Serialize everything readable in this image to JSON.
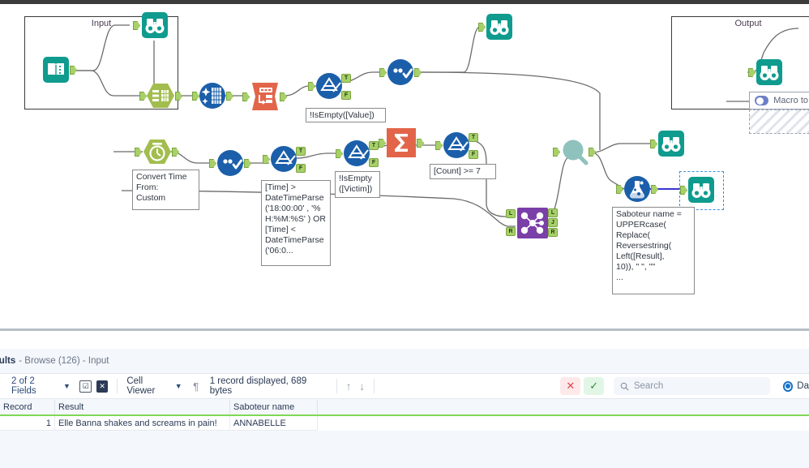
{
  "canvas": {
    "containers": [
      {
        "id": "input",
        "title": "Input"
      },
      {
        "id": "output",
        "title": "Output"
      }
    ],
    "macro_toggle": {
      "label": "Macro to",
      "state": "off"
    },
    "annotations": [
      {
        "id": "filter-value",
        "text": "!IsEmpty([Value])"
      },
      {
        "id": "convert-time",
        "text": "Convert Time\nFrom:\nCustom"
      },
      {
        "id": "time-filter",
        "text": "[Time]  >\nDateTimeParse\n('18:00:00' , '%\nH:%M:%S' ) OR\n[Time]  <\nDateTimeParse\n('06:0..."
      },
      {
        "id": "filter-victim",
        "text": "!IsEmpty\n([Victim])"
      },
      {
        "id": "count-filter",
        "text": "[Count] >= 7"
      },
      {
        "id": "formula-sab",
        "text": "Saboteur name =\nUPPERcase(\nReplace(\nReversestring(\nLeft([Result],\n10)), \" \", \"\"\n..."
      }
    ],
    "tools": [
      {
        "id": "input-data",
        "name": "input-data-tool",
        "icon": "book-icon",
        "color": "#0f9b8e"
      },
      {
        "id": "browse-top-1",
        "name": "browse-tool",
        "icon": "binoculars-icon",
        "color": "#0f9b8e"
      },
      {
        "id": "text-to-columns",
        "name": "text-to-columns-tool",
        "icon": "table-hex-icon",
        "color": "#a2bd4e"
      },
      {
        "id": "data-cleansing",
        "name": "data-cleansing-tool",
        "icon": "cleanse-icon",
        "color": "#1b5faa"
      },
      {
        "id": "transpose",
        "name": "transpose-tool",
        "icon": "transpose-icon",
        "color": "#e2654a"
      },
      {
        "id": "filter-1",
        "name": "filter-tool",
        "icon": "filter-icon",
        "color": "#1b5faa"
      },
      {
        "id": "select-1",
        "name": "select-tool",
        "icon": "select-icon",
        "color": "#1b5faa"
      },
      {
        "id": "browse-top-2",
        "name": "browse-tool",
        "icon": "binoculars-icon",
        "color": "#0f9b8e"
      },
      {
        "id": "browse-output",
        "name": "browse-tool",
        "icon": "binoculars-icon",
        "color": "#0f9b8e"
      },
      {
        "id": "datetime",
        "name": "datetime-tool",
        "icon": "clock-hex-icon",
        "color": "#a2bd4e"
      },
      {
        "id": "select-2",
        "name": "select-tool",
        "icon": "select-icon",
        "color": "#1b5faa"
      },
      {
        "id": "filter-2",
        "name": "filter-tool",
        "icon": "filter-icon",
        "color": "#1b5faa"
      },
      {
        "id": "filter-3",
        "name": "filter-tool",
        "icon": "filter-icon",
        "color": "#1b5faa"
      },
      {
        "id": "summarize",
        "name": "summarize-tool",
        "icon": "sigma-icon",
        "color": "#e2654a"
      },
      {
        "id": "filter-4",
        "name": "filter-tool",
        "icon": "filter-icon",
        "color": "#1b5faa"
      },
      {
        "id": "join",
        "name": "join-tool",
        "icon": "join-icon",
        "color": "#7b3fa8"
      },
      {
        "id": "unique",
        "name": "unique-tool",
        "icon": "magnifier-icon",
        "color": "#8fc1bd"
      },
      {
        "id": "browse-mid",
        "name": "browse-tool",
        "icon": "binoculars-icon",
        "color": "#0f9b8e"
      },
      {
        "id": "formula",
        "name": "formula-tool",
        "icon": "flask-icon",
        "color": "#1b5faa"
      },
      {
        "id": "browse-selected",
        "name": "browse-tool-selected",
        "icon": "binoculars-icon",
        "color": "#0f9b8e"
      }
    ]
  },
  "results": {
    "title": "esults",
    "subtitle": "- Browse (126) - Input",
    "toolbar": {
      "fields_label": "2 of 2 Fields",
      "check_icon": "checkbox-icon",
      "deselect_icon": "deselect-icon",
      "viewer_label": "Cell Viewer",
      "pilcrow_icon": "pilcrow-icon",
      "status": "1 record displayed, 689 bytes",
      "up_icon": "arrow-up-icon",
      "down_icon": "arrow-down-icon",
      "reject_icon": "x-icon",
      "accept_icon": "check-icon",
      "search_placeholder": "Search",
      "search_icon": "search-icon",
      "radio_label": "Da"
    },
    "grid": {
      "columns": [
        "Record",
        "Result",
        "Saboteur name"
      ],
      "rows": [
        {
          "record": "1",
          "result": "Elle Banna shakes and screams in pain!",
          "saboteur": "ANNABELLE"
        }
      ]
    }
  },
  "colors": {
    "teal": "#0f9b8e",
    "blue": "#1b5faa",
    "orange": "#e2654a",
    "green": "#a2bd4e",
    "purple": "#7b3fa8",
    "anchor": "#a8d06a",
    "grid_accent": "#7ed957",
    "selection": "#3a8fe0"
  }
}
